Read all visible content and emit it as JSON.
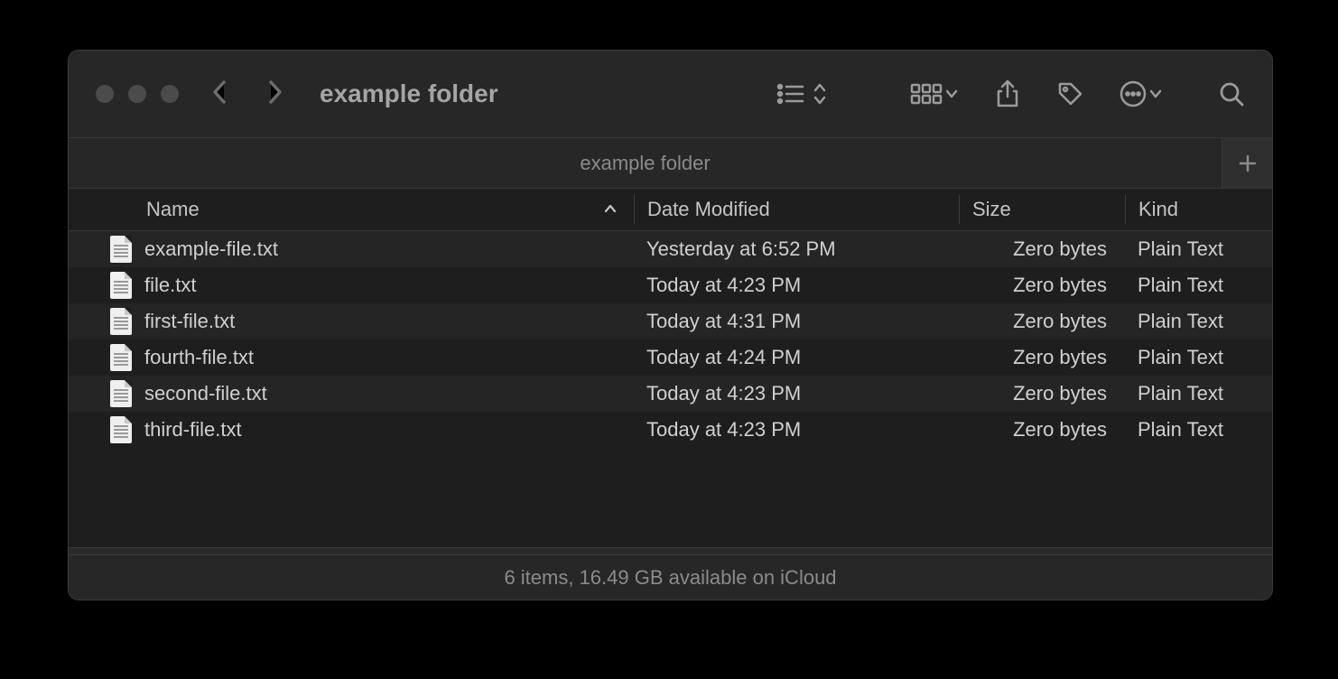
{
  "window": {
    "title": "example folder"
  },
  "tabbar": {
    "tabs": [
      {
        "label": "example folder"
      }
    ]
  },
  "columns": {
    "name": "Name",
    "date": "Date Modified",
    "size": "Size",
    "kind": "Kind",
    "sort_column": "name",
    "sort_dir": "asc"
  },
  "files": [
    {
      "name": "example-file.txt",
      "date": "Yesterday at 6:52 PM",
      "size": "Zero bytes",
      "kind": "Plain Text"
    },
    {
      "name": "file.txt",
      "date": "Today at 4:23 PM",
      "size": "Zero bytes",
      "kind": "Plain Text"
    },
    {
      "name": "first-file.txt",
      "date": "Today at 4:31 PM",
      "size": "Zero bytes",
      "kind": "Plain Text"
    },
    {
      "name": "fourth-file.txt",
      "date": "Today at 4:24 PM",
      "size": "Zero bytes",
      "kind": "Plain Text"
    },
    {
      "name": "second-file.txt",
      "date": "Today at 4:23 PM",
      "size": "Zero bytes",
      "kind": "Plain Text"
    },
    {
      "name": "third-file.txt",
      "date": "Today at 4:23 PM",
      "size": "Zero bytes",
      "kind": "Plain Text"
    }
  ],
  "status": {
    "text": "6 items, 16.49 GB available on iCloud"
  },
  "icons": {
    "view": "list-icon",
    "group": "group-icon",
    "share": "share-icon",
    "tags": "tag-icon",
    "actions": "ellipsis-icon",
    "search": "search-icon"
  }
}
